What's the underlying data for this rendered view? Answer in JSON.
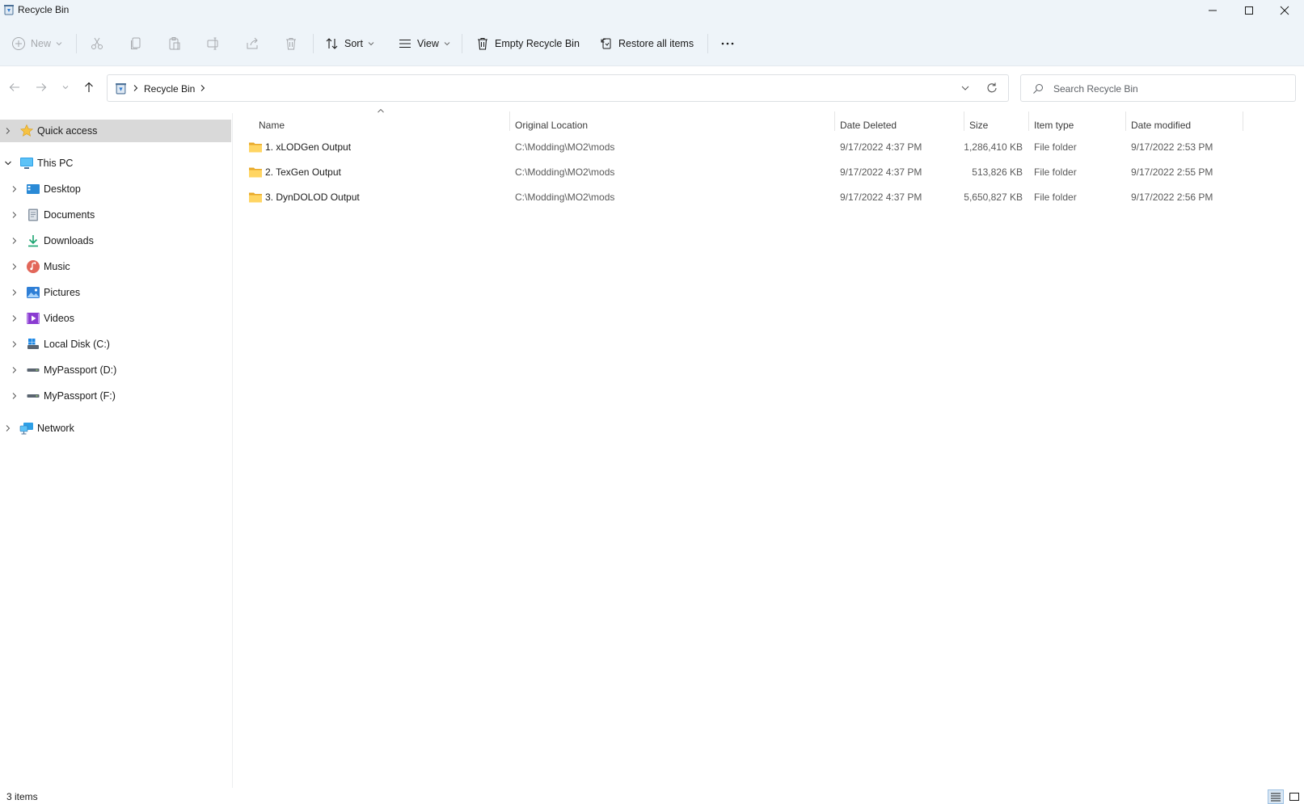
{
  "window": {
    "title": "Recycle Bin",
    "controls": [
      "minimize-icon",
      "maximize-icon",
      "close-icon"
    ]
  },
  "toolbar": {
    "new_label": "New",
    "sort_label": "Sort",
    "view_label": "View",
    "empty_label": "Empty Recycle Bin",
    "restore_label": "Restore all items",
    "disabled_icons": [
      "cut-icon",
      "copy-icon",
      "paste-icon",
      "rename-icon",
      "share-icon",
      "delete-icon"
    ]
  },
  "address": {
    "crumbs": [
      "Recycle Bin"
    ],
    "search_placeholder": "Search Recycle Bin"
  },
  "nav": {
    "items": [
      {
        "label": "Quick access",
        "icon": "star-icon",
        "selected": true
      },
      {
        "label": "This PC",
        "icon": "computer-icon",
        "expanded": true
      },
      {
        "label": "Desktop",
        "icon": "desktop-icon"
      },
      {
        "label": "Documents",
        "icon": "documents-icon"
      },
      {
        "label": "Downloads",
        "icon": "downloads-icon"
      },
      {
        "label": "Music",
        "icon": "music-icon"
      },
      {
        "label": "Pictures",
        "icon": "pictures-icon"
      },
      {
        "label": "Videos",
        "icon": "videos-icon"
      },
      {
        "label": "Local Disk (C:)",
        "icon": "local-disk-icon"
      },
      {
        "label": "MyPassport (D:)",
        "icon": "drive-icon"
      },
      {
        "label": "MyPassport (F:)",
        "icon": "drive-icon"
      },
      {
        "label": "Network",
        "icon": "network-icon"
      }
    ]
  },
  "columns": [
    "Name",
    "Original Location",
    "Date Deleted",
    "Size",
    "Item type",
    "Date modified"
  ],
  "files": [
    {
      "name": "1. xLODGen Output",
      "location": "C:\\Modding\\MO2\\mods",
      "deleted": "9/17/2022 4:37 PM",
      "size": "1,286,410 KB",
      "type": "File folder",
      "modified": "9/17/2022 2:53 PM"
    },
    {
      "name": "2. TexGen Output",
      "location": "C:\\Modding\\MO2\\mods",
      "deleted": "9/17/2022 4:37 PM",
      "size": "513,826 KB",
      "type": "File folder",
      "modified": "9/17/2022 2:55 PM"
    },
    {
      "name": "3. DynDOLOD Output",
      "location": "C:\\Modding\\MO2\\mods",
      "deleted": "9/17/2022 4:37 PM",
      "size": "5,650,827 KB",
      "type": "File folder",
      "modified": "9/17/2022 2:56 PM"
    }
  ],
  "status": {
    "item_count": "3 items"
  }
}
